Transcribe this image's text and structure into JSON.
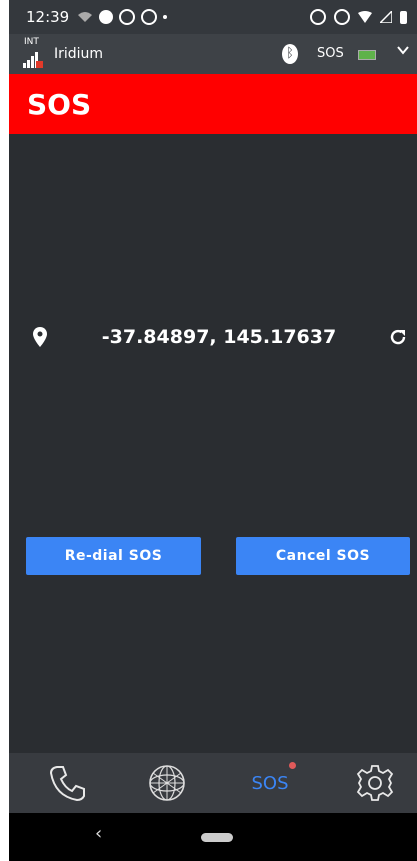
{
  "status_bar": {
    "time": "12:39"
  },
  "network_bar": {
    "int_label": "INT",
    "network_name": "Iridium",
    "sos_label": "SOS",
    "icons": [
      "signal-bars-icon",
      "bluetooth-icon",
      "battery-icon",
      "chevron-down-icon"
    ]
  },
  "header": {
    "title": "SOS",
    "color": "#ff0000"
  },
  "location": {
    "coordinates": "-37.84897, 145.17637"
  },
  "actions": {
    "redial_label": "Re-dial SOS",
    "cancel_label": "Cancel SOS",
    "button_color": "#3b85f5"
  },
  "bottom_nav": {
    "items": [
      {
        "name": "phone",
        "icon": "phone-icon"
      },
      {
        "name": "globe",
        "icon": "globe-icon"
      },
      {
        "name": "sos",
        "label": "SOS",
        "active": true
      },
      {
        "name": "settings",
        "icon": "gear-icon"
      }
    ]
  },
  "system_nav": {
    "back_glyph": "‹"
  }
}
